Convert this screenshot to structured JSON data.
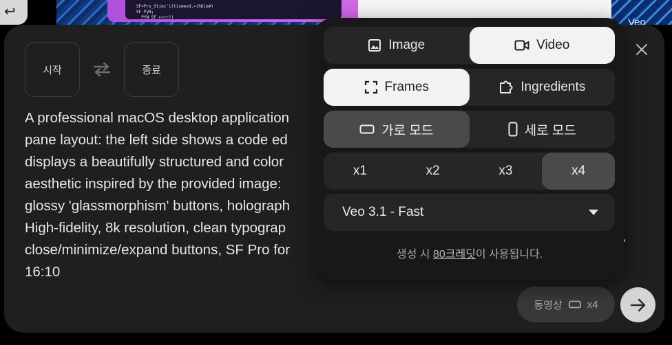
{
  "background": {
    "code_snippet": "SF=Pro_Stiec'i(tismeod,=(hDie#)\nSF-PyN;\n  PYN SF c=rr))",
    "thumb_label": "Veo"
  },
  "composer": {
    "start_frame_label": "시작",
    "end_frame_label": "종료",
    "prompt_lines": [
      "A professional macOS desktop application",
      "pane layout: the left side shows a code ed",
      "displays a beautifully structured and color",
      "aesthetic inspired by the provided image:",
      "glossy 'glassmorphism' buttons, holograph",
      "High-fidelity, 8k resolution, clean typograp",
      "close/minimize/expand buttons, SF Pro for",
      "16:10"
    ],
    "summary": {
      "type_label": "동영상",
      "count_label": "x4"
    }
  },
  "settings": {
    "media_type": {
      "options": [
        "Image",
        "Video"
      ],
      "selected": "Video"
    },
    "source_mode": {
      "options": [
        "Frames",
        "Ingredients"
      ],
      "selected": "Frames"
    },
    "orientation": {
      "options": [
        "가로 모드",
        "세로 모드"
      ],
      "selected": "가로 모드"
    },
    "count": {
      "options": [
        "x1",
        "x2",
        "x3",
        "x4"
      ],
      "selected": "x4"
    },
    "model": {
      "selected": "Veo 3.1 - Fast"
    },
    "credit_note": {
      "prefix": "생성 시 ",
      "credits": "80크레딧",
      "suffix": "이 사용됩니다."
    }
  },
  "colors": {
    "panel": "#1f1f1f",
    "popover": "#181818",
    "segment": "#262626",
    "selected_light": "#f2f2f2",
    "selected_dark": "#4a4a4a"
  }
}
